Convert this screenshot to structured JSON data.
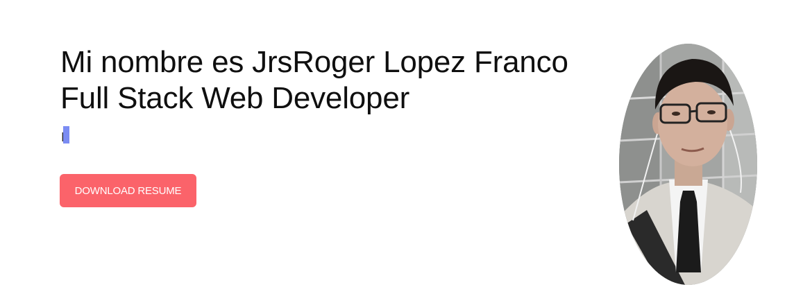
{
  "hero": {
    "line1": "Mi nombre es JrsRoger Lopez Franco",
    "line2": "Full Stack Web Developer",
    "typed_text": "I"
  },
  "actions": {
    "download_label": "DOWNLOAD RESUME"
  },
  "colors": {
    "button_bg": "#fb636a",
    "button_text": "#ffffff",
    "cursor": "#7b8cf3",
    "heading": "#0f0f0f"
  }
}
